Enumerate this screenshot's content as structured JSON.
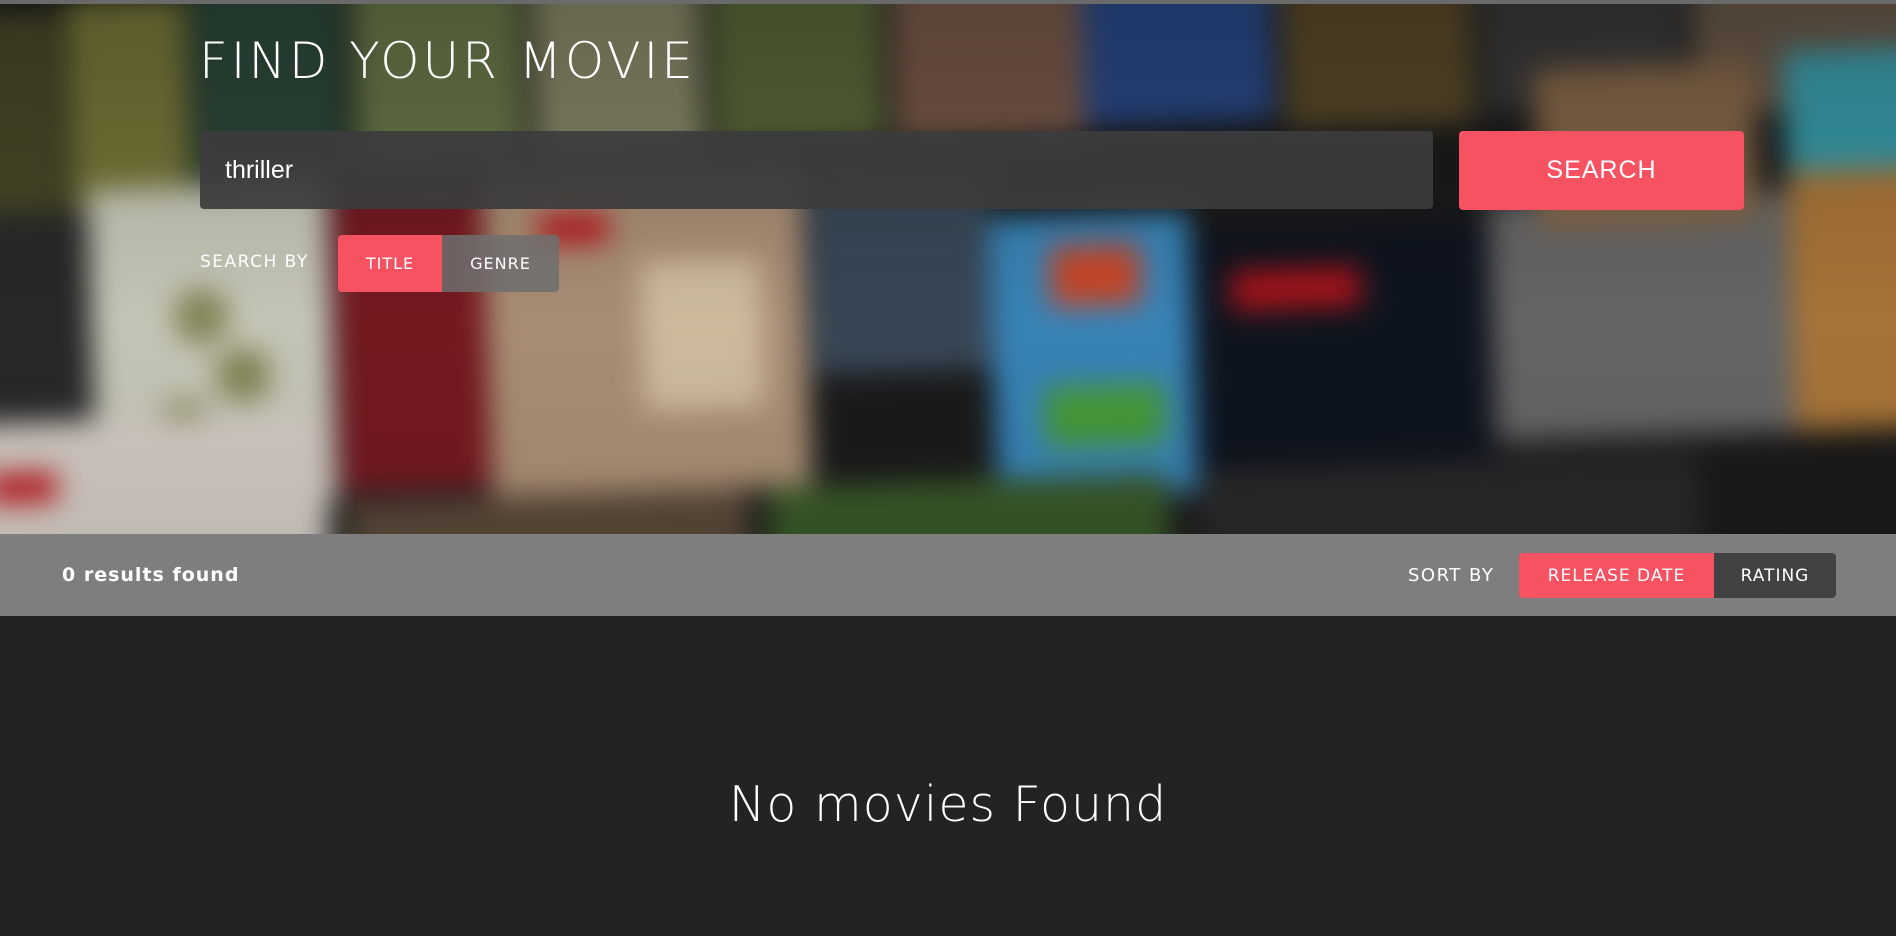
{
  "hero": {
    "title": "FIND YOUR MOVIE",
    "search_input": {
      "value": "thriller",
      "placeholder": ""
    },
    "search_button_label": "SEARCH",
    "search_by": {
      "label": "SEARCH BY",
      "options": [
        "TITLE",
        "GENRE"
      ],
      "selected": "TITLE"
    },
    "background_icon": "movie-posters-collage-image"
  },
  "results_bar": {
    "count_text": "0 results found",
    "sort_by": {
      "label": "SORT BY",
      "options": [
        "RELEASE DATE",
        "RATING"
      ],
      "selected": "RELEASE DATE"
    }
  },
  "main": {
    "empty_message": "No movies Found"
  },
  "colors": {
    "accent": "#f65261",
    "page_background": "#232323",
    "results_bar_background": "#7e7e7e",
    "input_background": "#3c3c3c",
    "inactive_toggle": "#424242",
    "text": "#ffffff"
  }
}
